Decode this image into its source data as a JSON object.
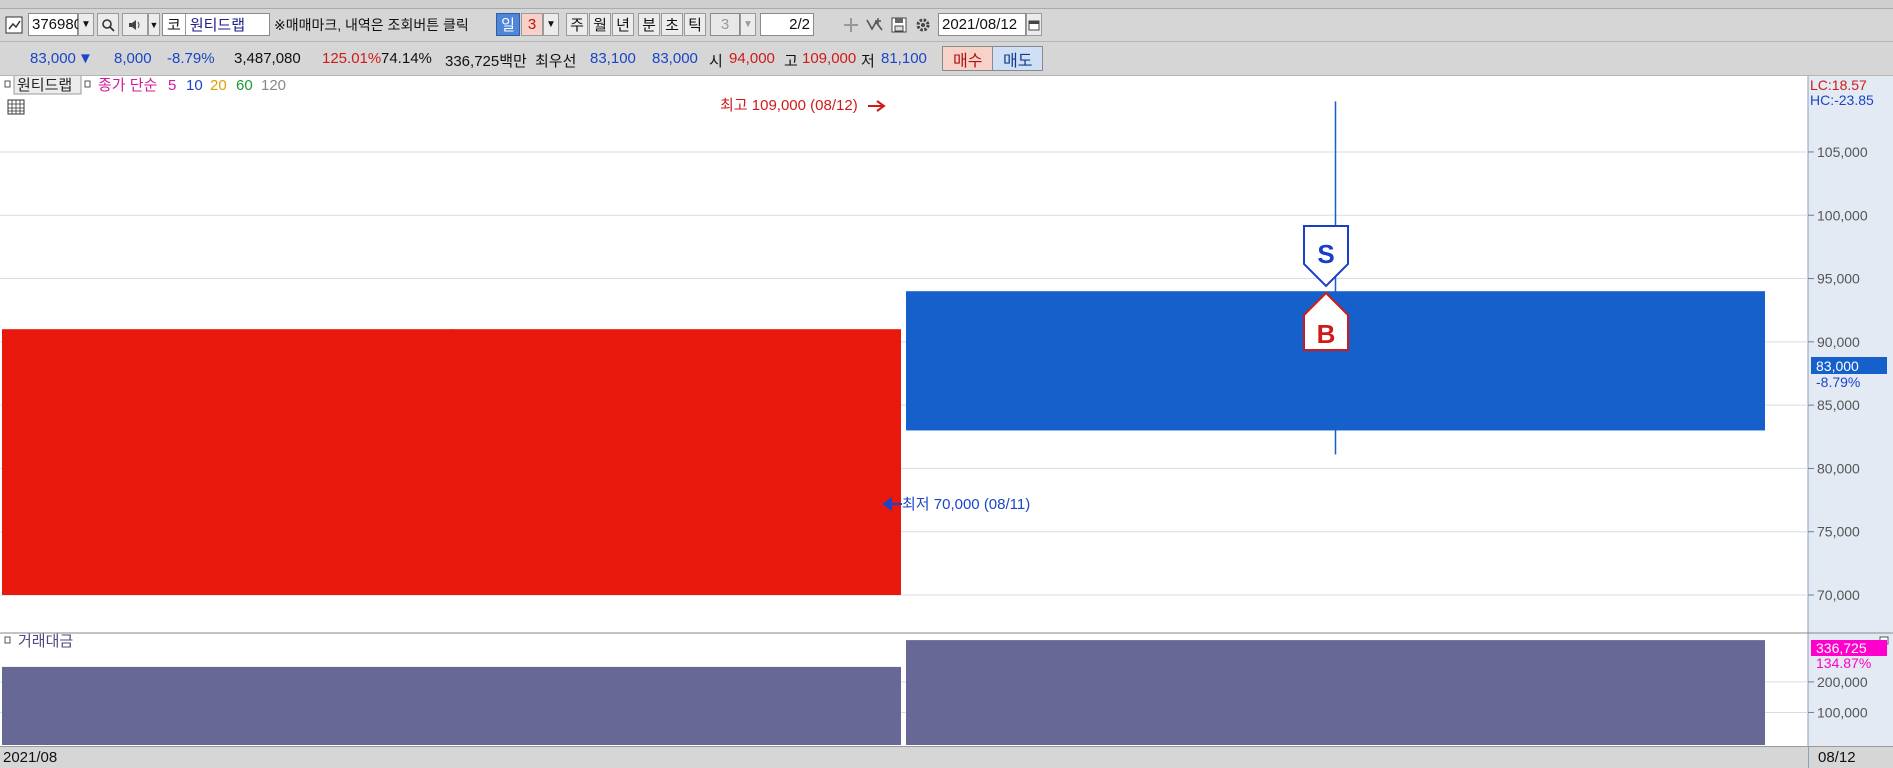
{
  "toolbar": {
    "code": "376980",
    "market_badge": "코",
    "stock_name": "원티드랩",
    "notice": "※매매마크, 내역은 조회버튼 클릭",
    "periods": [
      "일",
      "3",
      "주",
      "월",
      "년",
      "분",
      "초",
      "틱",
      "3"
    ],
    "page": "2/2",
    "date": "2021/08/12"
  },
  "quote": {
    "price": "83,000",
    "change_arrow": "▼",
    "change": "8,000",
    "change_pct": "-8.79%",
    "volume": "3,487,080",
    "ratio1": "125.01%",
    "ratio2": "74.14%",
    "amount": "336,725백만",
    "bid_label": "최우선",
    "bid1": "83,100",
    "bid2": "83,000",
    "open_label": "시",
    "open": "94,000",
    "high_label": "고",
    "high": "109,000",
    "low_label": "저",
    "low": "81,100",
    "buy_label": "매수",
    "sell_label": "매도"
  },
  "legend": {
    "name": "원티드랩",
    "ma_label": "종가 단순",
    "ma_periods": [
      "5",
      "10",
      "20",
      "60",
      "120"
    ],
    "ma_colors": [
      "#d01a9a",
      "#1a46c7",
      "#e0a000",
      "#1a9a30",
      "#888888"
    ]
  },
  "indicators": {
    "lc": "LC:18.57",
    "hc": "HC:-23.85",
    "current_price_tag": "83,000",
    "current_pct_tag": "-8.79%",
    "high_annotation": "최고 109,000 (08/12)",
    "low_annotation": "최저 70,000 (08/11)",
    "sell_mark": "S",
    "buy_mark": "B"
  },
  "volume_panel": {
    "title": "거래대금",
    "last_tag": "336,725",
    "last_pct_tag": "134.87%"
  },
  "footer": {
    "left_label": "2021/08",
    "right_label": "08/12"
  },
  "chart_data": {
    "type": "candlestick",
    "dates": [
      "08/11",
      "08/12"
    ],
    "candles": [
      {
        "date": "08/11",
        "open": 70000,
        "high": 91000,
        "low": 70000,
        "close": 91000,
        "color": "#e8190c"
      },
      {
        "date": "08/12",
        "open": 94000,
        "high": 109000,
        "low": 81100,
        "close": 83000,
        "color": "#1660cc"
      }
    ],
    "price_axis": {
      "ylim": [
        67000,
        111000
      ],
      "ticks": [
        70000,
        75000,
        80000,
        85000,
        90000,
        95000,
        100000,
        105000
      ],
      "tick_labels": [
        "70,000",
        "75,000",
        "80,000",
        "85,000",
        "90,000",
        "95,000",
        "100,000",
        "105,000"
      ]
    },
    "volume": {
      "values": [
        249000,
        336725
      ],
      "color": "#686896",
      "ylim": [
        0,
        360000
      ],
      "ticks": [
        100000,
        200000
      ],
      "tick_labels": [
        "100,000",
        "200,000"
      ]
    },
    "trade_marks": [
      {
        "date": "08/12",
        "type": "sell",
        "label": "S",
        "price": 94000
      },
      {
        "date": "08/12",
        "type": "buy",
        "label": "B",
        "price": 94000
      }
    ]
  }
}
